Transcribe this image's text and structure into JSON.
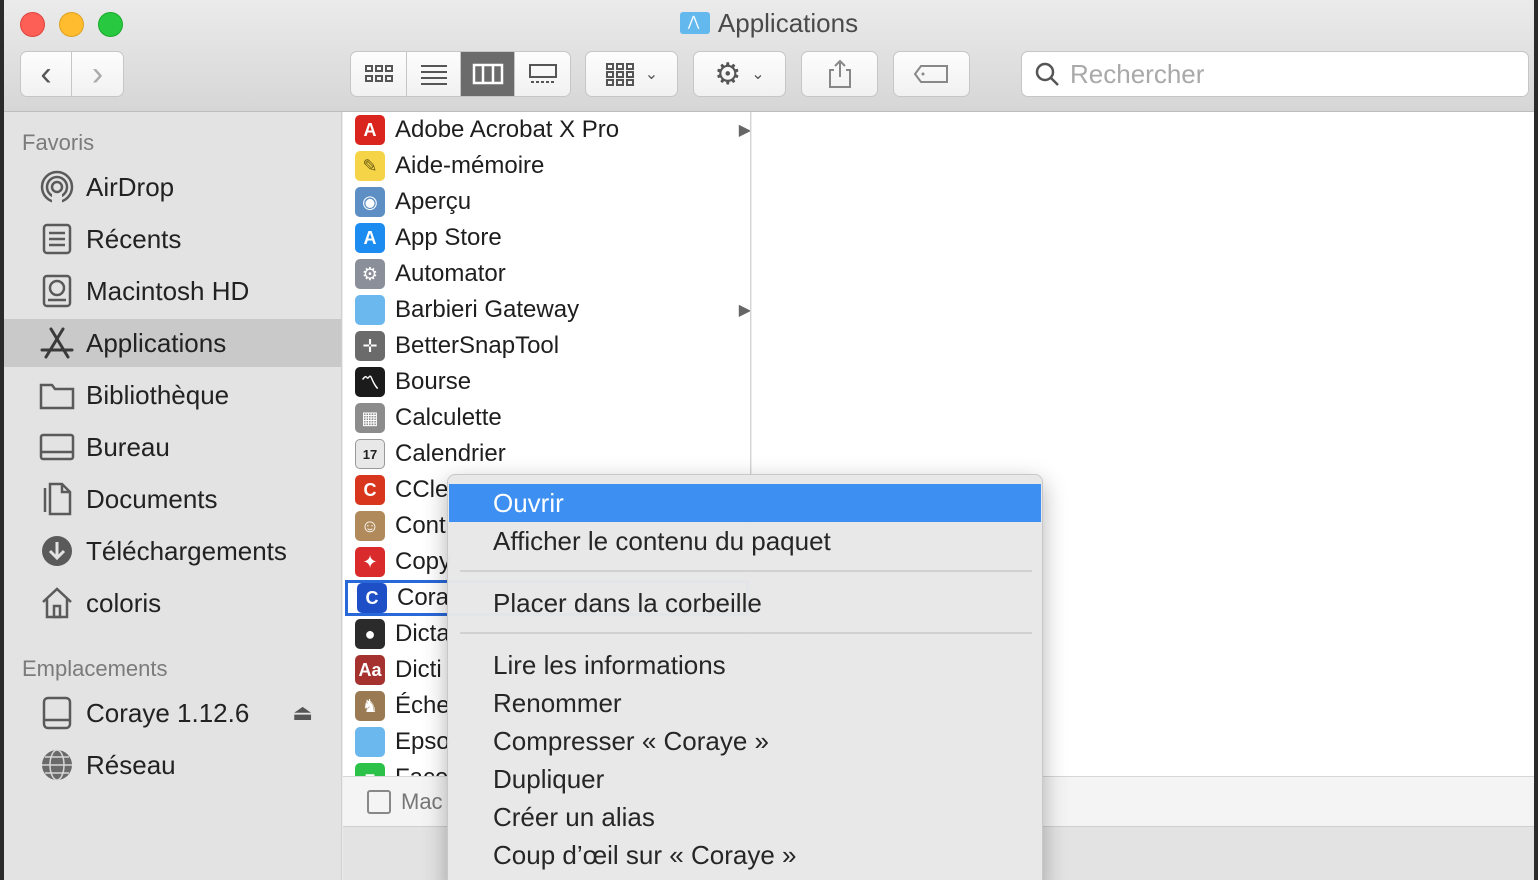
{
  "window": {
    "title": "Applications"
  },
  "toolbar": {
    "back": "‹",
    "forward": "›",
    "search_placeholder": "Rechercher"
  },
  "sidebar": {
    "favorites_header": "Favoris",
    "locations_header": "Emplacements",
    "favorites": [
      {
        "label": "AirDrop",
        "icon": "airdrop-icon"
      },
      {
        "label": "Récents",
        "icon": "recents-icon"
      },
      {
        "label": "Macintosh HD",
        "icon": "hard-drive-icon"
      },
      {
        "label": "Applications",
        "icon": "applications-icon",
        "selected": true
      },
      {
        "label": "Bibliothèque",
        "icon": "folder-icon"
      },
      {
        "label": "Bureau",
        "icon": "desktop-icon"
      },
      {
        "label": "Documents",
        "icon": "document-icon"
      },
      {
        "label": "Téléchargements",
        "icon": "download-icon"
      },
      {
        "label": "coloris",
        "icon": "home-icon"
      }
    ],
    "locations": [
      {
        "label": "Coraye 1.12.6",
        "icon": "disk-icon",
        "eject": "⏏"
      },
      {
        "label": "Réseau",
        "icon": "network-icon"
      }
    ]
  },
  "files": [
    {
      "label": "Adobe Acrobat X Pro",
      "icon": "acrobat-icon",
      "color": "#d9251d",
      "glyph": "A",
      "folder": true
    },
    {
      "label": "Aide-mémoire",
      "icon": "stickies-icon",
      "color": "#f5d547",
      "glyph": "✎"
    },
    {
      "label": "Aperçu",
      "icon": "preview-icon",
      "color": "#5d8fc4",
      "glyph": "◉"
    },
    {
      "label": "App Store",
      "icon": "app-store-icon",
      "color": "#1d8cf0",
      "glyph": "A"
    },
    {
      "label": "Automator",
      "icon": "automator-icon",
      "color": "#8a8f99",
      "glyph": "⚙"
    },
    {
      "label": "Barbieri Gateway",
      "icon": "folder-icon",
      "color": "#6ab8ee",
      "glyph": "",
      "folder": true
    },
    {
      "label": "BetterSnapTool",
      "icon": "bettersnaptool-icon",
      "color": "#6b6b6b",
      "glyph": "✛"
    },
    {
      "label": "Bourse",
      "icon": "stocks-icon",
      "color": "#1b1b1b",
      "glyph": "〽"
    },
    {
      "label": "Calculette",
      "icon": "calculator-icon",
      "color": "#8c8c8c",
      "glyph": "▦"
    },
    {
      "label": "Calendrier",
      "icon": "calendar-icon",
      "color": "#e8e8e8",
      "glyph": "17"
    },
    {
      "label": "CCle",
      "icon": "ccleaner-icon",
      "color": "#d9361e",
      "glyph": "C"
    },
    {
      "label": "Cont",
      "icon": "contacts-icon",
      "color": "#b08a5a",
      "glyph": "☺"
    },
    {
      "label": "Copy",
      "icon": "copy-icon",
      "color": "#d92b2b",
      "glyph": "✦"
    },
    {
      "label": "Cora",
      "icon": "coraye-icon",
      "color": "#1f4fc7",
      "glyph": "C",
      "focused": true
    },
    {
      "label": "Dicta",
      "icon": "dictation-icon",
      "color": "#2b2b2b",
      "glyph": "●"
    },
    {
      "label": "Dicti",
      "icon": "dictionary-icon",
      "color": "#a6322f",
      "glyph": "Aa"
    },
    {
      "label": "Éche",
      "icon": "chess-icon",
      "color": "#9a7a52",
      "glyph": "♞"
    },
    {
      "label": "Epso",
      "icon": "folder-icon",
      "color": "#6ab8ee",
      "glyph": ""
    },
    {
      "label": "Face",
      "icon": "facetime-icon",
      "color": "#2cc24a",
      "glyph": "■"
    }
  ],
  "pathbar": {
    "label": "Mac"
  },
  "context_menu": {
    "groups": [
      [
        {
          "label": "Ouvrir",
          "highlighted": true
        },
        {
          "label": "Afficher le contenu du paquet"
        }
      ],
      [
        {
          "label": "Placer dans la corbeille"
        }
      ],
      [
        {
          "label": "Lire les informations"
        },
        {
          "label": "Renommer"
        },
        {
          "label": "Compresser « Coraye »"
        },
        {
          "label": "Dupliquer"
        },
        {
          "label": "Créer un alias"
        },
        {
          "label": "Coup d’œil sur « Coraye »"
        }
      ]
    ]
  }
}
